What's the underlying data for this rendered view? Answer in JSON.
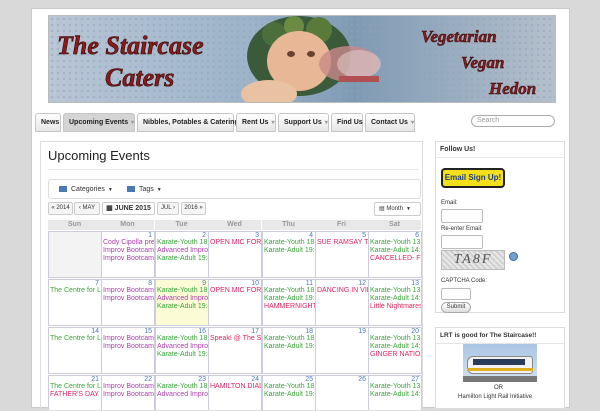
{
  "banner": {
    "left_lines": [
      "The Staircase",
      "Caters"
    ],
    "right_lines": [
      "Vegetarian",
      "Vegan",
      "Hedon"
    ]
  },
  "nav": {
    "tabs": [
      {
        "label": "News",
        "arrow": false
      },
      {
        "label": "Upcoming Events",
        "arrow": true,
        "active": true
      },
      {
        "label": "Nibbles, Potables & Catering",
        "arrow": false
      },
      {
        "label": "Rent Us",
        "arrow": true
      },
      {
        "label": "Support Us",
        "arrow": true
      },
      {
        "label": "Find Us",
        "arrow": false
      },
      {
        "label": "Contact Us",
        "arrow": true
      }
    ],
    "search_placeholder": "Search"
  },
  "main": {
    "title": "Upcoming Events",
    "filters": {
      "categories": "Categories",
      "tags": "Tags"
    },
    "nav_buttons": {
      "prev_year": "« 2014",
      "prev_month": "‹ MAY",
      "current": "JUNE 2015",
      "next_month": "JUL ›",
      "next_year": "2016 »"
    },
    "view_select": "Month",
    "day_headers": [
      "Sun",
      "Mon",
      "Tue",
      "Wed",
      "Thu",
      "Fri",
      "Sat"
    ],
    "weeks": [
      [
        {
          "day": "",
          "other": true,
          "events": []
        },
        {
          "day": "1",
          "events": [
            {
              "text": "Cody Cipolla prese",
              "color": "#b03cb0"
            },
            {
              "text": "Improv Bootcamp",
              "color": "#b03cb0"
            },
            {
              "text": "Improv Bootcamp",
              "color": "#b03cb0"
            }
          ]
        },
        {
          "day": "2",
          "events": [
            {
              "text": "Karate-Youth 18:",
              "color": "#3aa63a"
            },
            {
              "text": "Advanced Improv",
              "color": "#b03cb0"
            },
            {
              "text": "Karate-Adult 19:0",
              "color": "#3aa63a"
            }
          ]
        },
        {
          "day": "3",
          "events": [
            {
              "text": "OPEN MIC FOR MU",
              "color": "#e0245e"
            }
          ]
        },
        {
          "day": "4",
          "events": [
            {
              "text": "Karate-Youth 18:",
              "color": "#3aa63a"
            },
            {
              "text": "Karate-Adult 19:0",
              "color": "#3aa63a"
            }
          ]
        },
        {
          "day": "5",
          "events": [
            {
              "text": "SUE RAMSAY TRIC",
              "color": "#e0245e"
            }
          ]
        },
        {
          "day": "6",
          "events": [
            {
              "text": "Karate-Youth 13:",
              "color": "#3aa63a"
            },
            {
              "text": "Karate-Adult 14:0",
              "color": "#3aa63a"
            },
            {
              "text": "CANCELLED- FRIG",
              "color": "#e0245e"
            }
          ]
        }
      ],
      [
        {
          "day": "7",
          "events": [
            {
              "text": "The Centre for Lif",
              "color": "#3aa63a"
            }
          ]
        },
        {
          "day": "8",
          "events": [
            {
              "text": "Improv Bootcamp",
              "color": "#b03cb0"
            },
            {
              "text": "Improv Bootcamp",
              "color": "#b03cb0"
            }
          ]
        },
        {
          "day": "9",
          "today": true,
          "events": [
            {
              "text": "Karate-Youth 18:",
              "color": "#3aa63a"
            },
            {
              "text": "Advanced Improv",
              "color": "#b03cb0"
            },
            {
              "text": "Karate-Adult 19:0",
              "color": "#3aa63a"
            }
          ]
        },
        {
          "day": "10",
          "events": [
            {
              "text": "OPEN MIC FOR MU",
              "color": "#e0245e"
            }
          ]
        },
        {
          "day": "11",
          "events": [
            {
              "text": "Karate-Youth 18:",
              "color": "#3aa63a"
            },
            {
              "text": "Karate-Adult 19:0",
              "color": "#3aa63a"
            },
            {
              "text": "HAMMERNIGHT LI",
              "color": "#e0245e"
            }
          ]
        },
        {
          "day": "12",
          "events": [
            {
              "text": "DANCING IN VIEN",
              "color": "#e0245e"
            }
          ]
        },
        {
          "day": "13",
          "events": [
            {
              "text": "Karate-Youth 13:",
              "color": "#3aa63a"
            },
            {
              "text": "Karate-Adult 14:0",
              "color": "#3aa63a"
            },
            {
              "text": "Little Nightmares",
              "color": "#e0245e"
            }
          ]
        }
      ],
      [
        {
          "day": "14",
          "events": [
            {
              "text": "The Centre for Lif",
              "color": "#3aa63a"
            }
          ]
        },
        {
          "day": "15",
          "events": [
            {
              "text": "Improv Bootcamp",
              "color": "#b03cb0"
            },
            {
              "text": "Improv Bootcamp",
              "color": "#b03cb0"
            }
          ]
        },
        {
          "day": "16",
          "events": [
            {
              "text": "Karate-Youth 18:",
              "color": "#3aa63a"
            },
            {
              "text": "Advanced Improv",
              "color": "#b03cb0"
            },
            {
              "text": "Karate-Adult 19:0",
              "color": "#3aa63a"
            }
          ]
        },
        {
          "day": "17",
          "events": [
            {
              "text": "Speak! @ The Sta",
              "color": "#e0245e"
            }
          ]
        },
        {
          "day": "18",
          "events": [
            {
              "text": "Karate-Youth 18:",
              "color": "#3aa63a"
            },
            {
              "text": "Karate-Adult 19:0",
              "color": "#3aa63a"
            }
          ]
        },
        {
          "day": "19",
          "events": []
        },
        {
          "day": "20",
          "events": [
            {
              "text": "Karate-Youth 13:",
              "color": "#3aa63a"
            },
            {
              "text": "Karate-Adult 14:0",
              "color": "#3aa63a"
            },
            {
              "text": "GINGER NATION B",
              "color": "#e0245e"
            }
          ]
        }
      ],
      [
        {
          "day": "21",
          "events": [
            {
              "text": "The Centre for Lif",
              "color": "#3aa63a"
            },
            {
              "text": "FATHER'S DAY C",
              "color": "#e0245e"
            }
          ]
        },
        {
          "day": "22",
          "events": [
            {
              "text": "Improv Bootcamp",
              "color": "#b03cb0"
            },
            {
              "text": "Improv Bootcamp",
              "color": "#b03cb0"
            }
          ]
        },
        {
          "day": "23",
          "events": [
            {
              "text": "Karate-Youth 18:",
              "color": "#3aa63a"
            },
            {
              "text": "Advanced Improv",
              "color": "#b03cb0"
            }
          ]
        },
        {
          "day": "24",
          "events": [
            {
              "text": "HAMILTON DIALO",
              "color": "#e0245e"
            }
          ]
        },
        {
          "day": "25",
          "events": [
            {
              "text": "Karate-Youth 18:",
              "color": "#3aa63a"
            },
            {
              "text": "Karate-Adult 19:0",
              "color": "#3aa63a"
            }
          ]
        },
        {
          "day": "26",
          "events": []
        },
        {
          "day": "27",
          "events": [
            {
              "text": "Karate-Youth 13:",
              "color": "#3aa63a"
            },
            {
              "text": "Karate-Adult 14:0",
              "color": "#3aa63a"
            }
          ]
        }
      ]
    ]
  },
  "sidebar": {
    "follow": {
      "title": "Follow Us!",
      "signup_label": "Email Sign Up!",
      "email_label": "Email:",
      "reenter_label": "Re-enter Email:",
      "captcha_text": "TA8F",
      "captcha_code_label": "CAPTCHA Code:",
      "submit_label": "Submit"
    },
    "lrt": {
      "title": "LRT is good for The Staircase!!",
      "or_text": "OR",
      "caption": "Hamilton Light Rail Initiative"
    }
  },
  "colors": {
    "accent": "#4a7ab5",
    "green": "#3aa63a",
    "purple": "#b03cb0",
    "red": "#e0245e",
    "banner_red": "#8b1a1a"
  }
}
